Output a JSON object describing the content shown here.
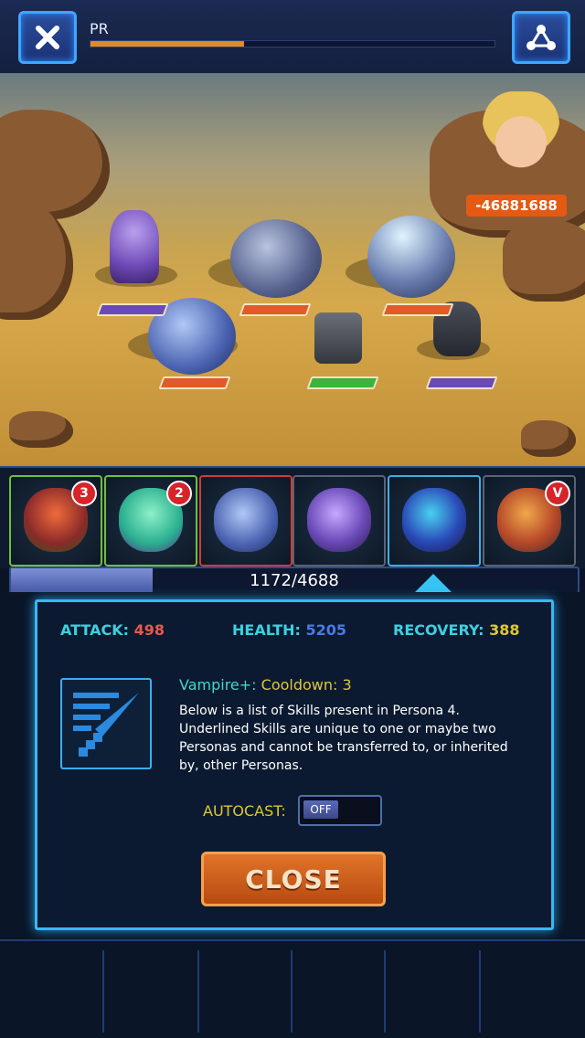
{
  "topbar": {
    "title": "PR",
    "xp_progress": 0.38,
    "close_icon": "close-icon",
    "network_icon": "network-icon"
  },
  "battle": {
    "enemy_damage": "-46881688",
    "enemy_hp_colors": [
      "#6a4ab8",
      "#e05a2a",
      "#e05a2a",
      "#e05a2a",
      "#3ab43a",
      "#6a4ab8"
    ]
  },
  "roster": {
    "slots": [
      {
        "badge": "3"
      },
      {
        "badge": "2"
      },
      {
        "badge": ""
      },
      {
        "badge": ""
      },
      {
        "badge": ""
      },
      {
        "badge": "V"
      }
    ]
  },
  "energy": {
    "text": "1172/4688",
    "fraction": 0.25
  },
  "stats": {
    "attack_label": "ATTACK:",
    "attack_value": "498",
    "health_label": "HEALTH:",
    "health_value": "5205",
    "recovery_label": "RECOVERY:",
    "recovery_value": "388",
    "colors": {
      "attack": "#e85a4a",
      "health": "#4a7ae8",
      "recovery": "#e0c830"
    }
  },
  "skill": {
    "name": "Vampire+:",
    "cooldown": "Cooldown: 3",
    "description": "Below is a list of Skills present in Persona 4. Underlined Skills are unique to one or maybe two Personas and cannot be transferred to, or inherited by, other Personas.",
    "icon": "sword-skill-icon"
  },
  "autocast": {
    "label": "AUTOCAST:",
    "state": "OFF"
  },
  "buttons": {
    "close_label": "CLOSE"
  }
}
